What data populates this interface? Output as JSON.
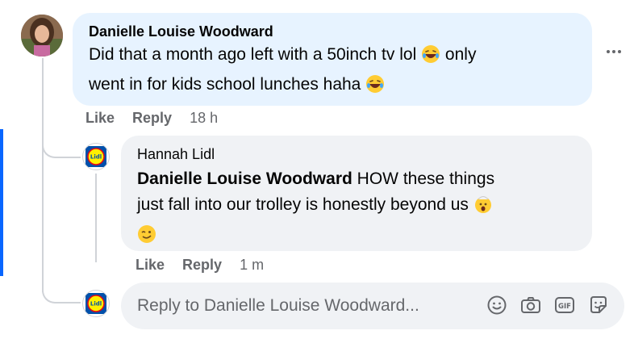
{
  "comment": {
    "author": "Danielle Louise Woodward",
    "line1": "Did that a month ago left with a 50inch tv lol",
    "line1_tail": "only",
    "line2": "went in for kids school lunches haha",
    "actions": {
      "like": "Like",
      "reply": "Reply",
      "time": "18 h"
    }
  },
  "reply": {
    "author": "Hannah Lidl",
    "mention": "Danielle Louise Woodward",
    "line1": "HOW these things",
    "line2": "just fall into our trolley is honestly beyond us",
    "actions": {
      "like": "Like",
      "reply": "Reply",
      "time": "1 m"
    }
  },
  "composer": {
    "placeholder": "Reply to Danielle Louise Woodward...",
    "icons": [
      "emoji-icon",
      "camera-icon",
      "gif-icon",
      "sticker-icon"
    ]
  },
  "colors": {
    "comment_bubble": "#e7f3ff",
    "reply_bubble": "#f0f2f5",
    "secondary_text": "#65676b",
    "focus_bar": "#0866ff",
    "lidl_blue": "#0050aa",
    "lidl_yellow": "#fff000",
    "lidl_red": "#e60a14"
  }
}
